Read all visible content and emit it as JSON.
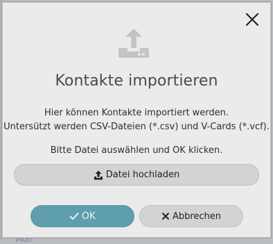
{
  "dialog": {
    "title": "Kontakte importieren",
    "description_line1": "Hier können Kontakte importiert werden.",
    "description_line2": "Untersützt werden CSV-Dateien (*.csv) und V-Cards (*.vcf).",
    "hint": "Bitte Datei auswählen und OK klicken.",
    "upload_label": "Datei hochladen",
    "ok_label": "OK",
    "cancel_label": "Abbrechen",
    "icons": {
      "header": "upload-icon",
      "close": "close-icon",
      "upload_button": "upload-icon",
      "ok": "check-icon",
      "cancel": "x-icon"
    }
  },
  "background": {
    "bottom_fragment": "Mon"
  },
  "colors": {
    "dialog_bg": "#ebebeb",
    "ok_bg": "#5f9eae",
    "ok_text": "#e8f3f6",
    "secondary_button_bg": "#d3d3d3",
    "icon_gray": "#c4c4c4",
    "title_text": "#4a4a4a"
  }
}
